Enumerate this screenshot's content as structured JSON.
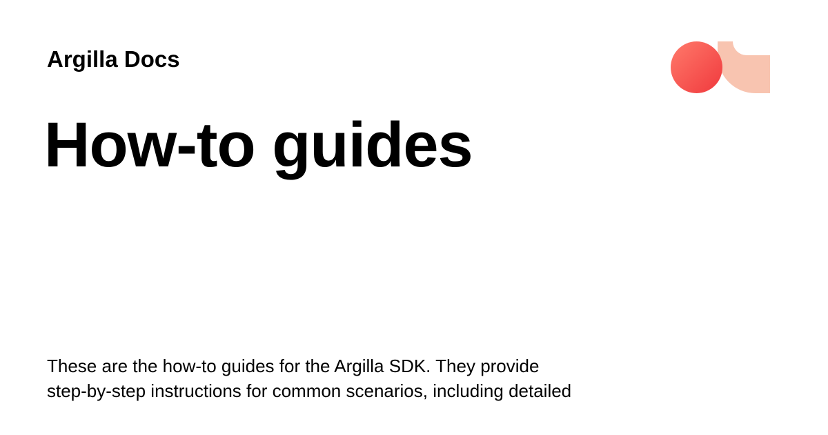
{
  "site": {
    "name": "Argilla Docs"
  },
  "page": {
    "title": "How-to guides",
    "description_lines": [
      "These are the how-to guides for the Argilla SDK. They provide",
      "step-by-step instructions for common scenarios, including detailed"
    ]
  },
  "logo": {
    "icon": "argilla-logo-icon",
    "colors": {
      "circle_light": "#ff7a6b",
      "circle_dark": "#f0393d",
      "arc": "#f8c4b0"
    }
  }
}
